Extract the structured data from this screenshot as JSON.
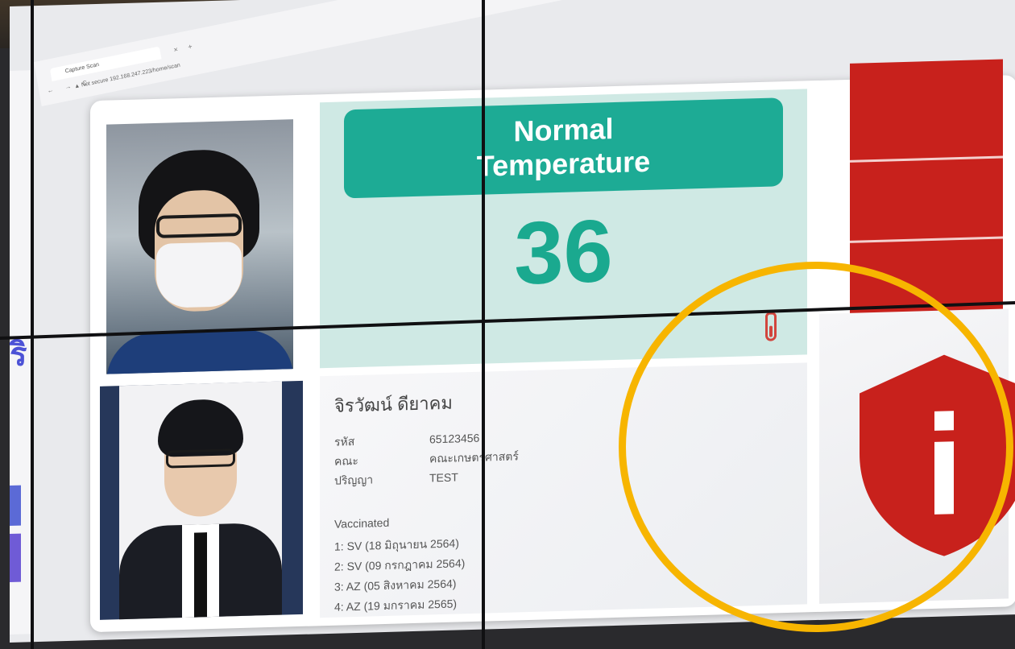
{
  "browser": {
    "tab_title": "Capture Scan",
    "tab_close": "×",
    "tab_new": "+",
    "nav": "← → C",
    "address": "▲ Not secure  192.168.247.223/home/scan"
  },
  "left_panel": {
    "letter": "ริ"
  },
  "temperature": {
    "status_line1": "Normal",
    "status_line2": "Temperature",
    "value": "36",
    "status_color": "#1dab95",
    "value_color": "#1aa98f"
  },
  "person": {
    "name": "จิรวัฒน์ ดียาคม",
    "fields": [
      {
        "label": "รหัส",
        "value": "65123456"
      },
      {
        "label": "คณะ",
        "value": "คณะเกษตรศาสตร์"
      },
      {
        "label": "ปริญญา",
        "value": "TEST"
      }
    ],
    "vaccinated_title": "Vaccinated",
    "vaccinations": [
      "1: SV (18 มิถุนายน 2564)",
      "2: SV (09 กรกฎาคม 2564)",
      "3: AZ (05 สิงหาคม 2564)",
      "4: AZ (19 มกราคม 2565)"
    ]
  },
  "alert": {
    "icon": "shield-info-icon",
    "color": "#c8211c"
  },
  "highlight_color": "#f7b500"
}
